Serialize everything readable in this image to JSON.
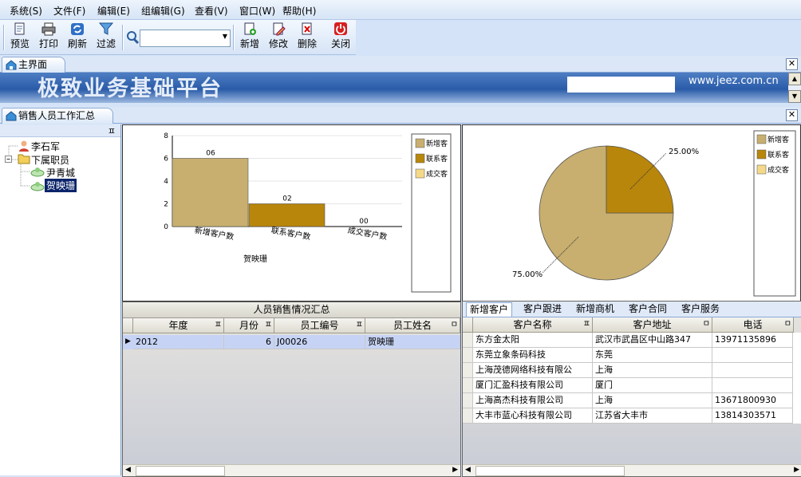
{
  "menu": [
    "系统(S)",
    "文件(F)",
    "编辑(E)",
    "组编辑(G)",
    "查看(V)",
    "窗口(W)",
    "帮助(H)"
  ],
  "toolbar": {
    "preview": "预览",
    "print": "打印",
    "refresh": "刷新",
    "filter": "过滤",
    "add": "新增",
    "edit": "修改",
    "delete": "删除",
    "close": "关闭"
  },
  "main_tab": "主界面",
  "banner": {
    "title": "极致业务基础平台",
    "url": "www.jeez.com.cn"
  },
  "report_tab": "销售人员工作汇总",
  "tree": {
    "pin": "ㅍ",
    "root": "李石军",
    "group": "下属职员",
    "members": [
      "尹青城",
      "贺映珊"
    ]
  },
  "chart_data": [
    {
      "type": "bar",
      "categories": [
        "新增客户数",
        "联系客户数",
        "成交客户数"
      ],
      "values": [
        6,
        2,
        0
      ],
      "value_labels": [
        "06",
        "02",
        "00"
      ],
      "ylim": [
        0,
        8
      ],
      "yticks": [
        0,
        2,
        4,
        6,
        8
      ],
      "xlabel": "贺映珊",
      "legend": [
        "新增客",
        "联系客",
        "成交客"
      ],
      "colors": [
        "#c8af6f",
        "#b8860b",
        "#f5d98a"
      ],
      "legend_position": "right"
    },
    {
      "type": "pie",
      "categories": [
        "新增客户数",
        "联系客户数",
        "成交客户数"
      ],
      "values": [
        75,
        25,
        0
      ],
      "labels": [
        "75.00%",
        "25.00%"
      ],
      "legend": [
        "新增客",
        "联系客",
        "成交客"
      ],
      "colors": [
        "#c8af6f",
        "#b8860b",
        "#f5d98a"
      ],
      "legend_position": "right"
    }
  ],
  "summary": {
    "title": "人员销售情况汇总",
    "columns": [
      "年度",
      "月份",
      "员工编号",
      "员工姓名"
    ],
    "rows": [
      [
        "2012",
        "6",
        "J00026",
        "贺映珊"
      ]
    ]
  },
  "customers": {
    "tabs": [
      "新增客户",
      "客户跟进",
      "新增商机",
      "客户合同",
      "客户服务"
    ],
    "columns": [
      "客户名称",
      "客户地址",
      "电话"
    ],
    "rows": [
      [
        "东方金太阳",
        "武汉市武昌区中山路347",
        "13971135896"
      ],
      [
        "东莞立象条码科技",
        "东莞",
        ""
      ],
      [
        "上海茂德网络科技有限公",
        "上海",
        ""
      ],
      [
        "厦门汇盈科技有限公司",
        "厦门",
        ""
      ],
      [
        "上海高杰科技有限公司",
        "上海",
        "13671800930"
      ],
      [
        "大丰市蓝心科技有限公司",
        "江苏省大丰市",
        "13814303571"
      ]
    ]
  }
}
